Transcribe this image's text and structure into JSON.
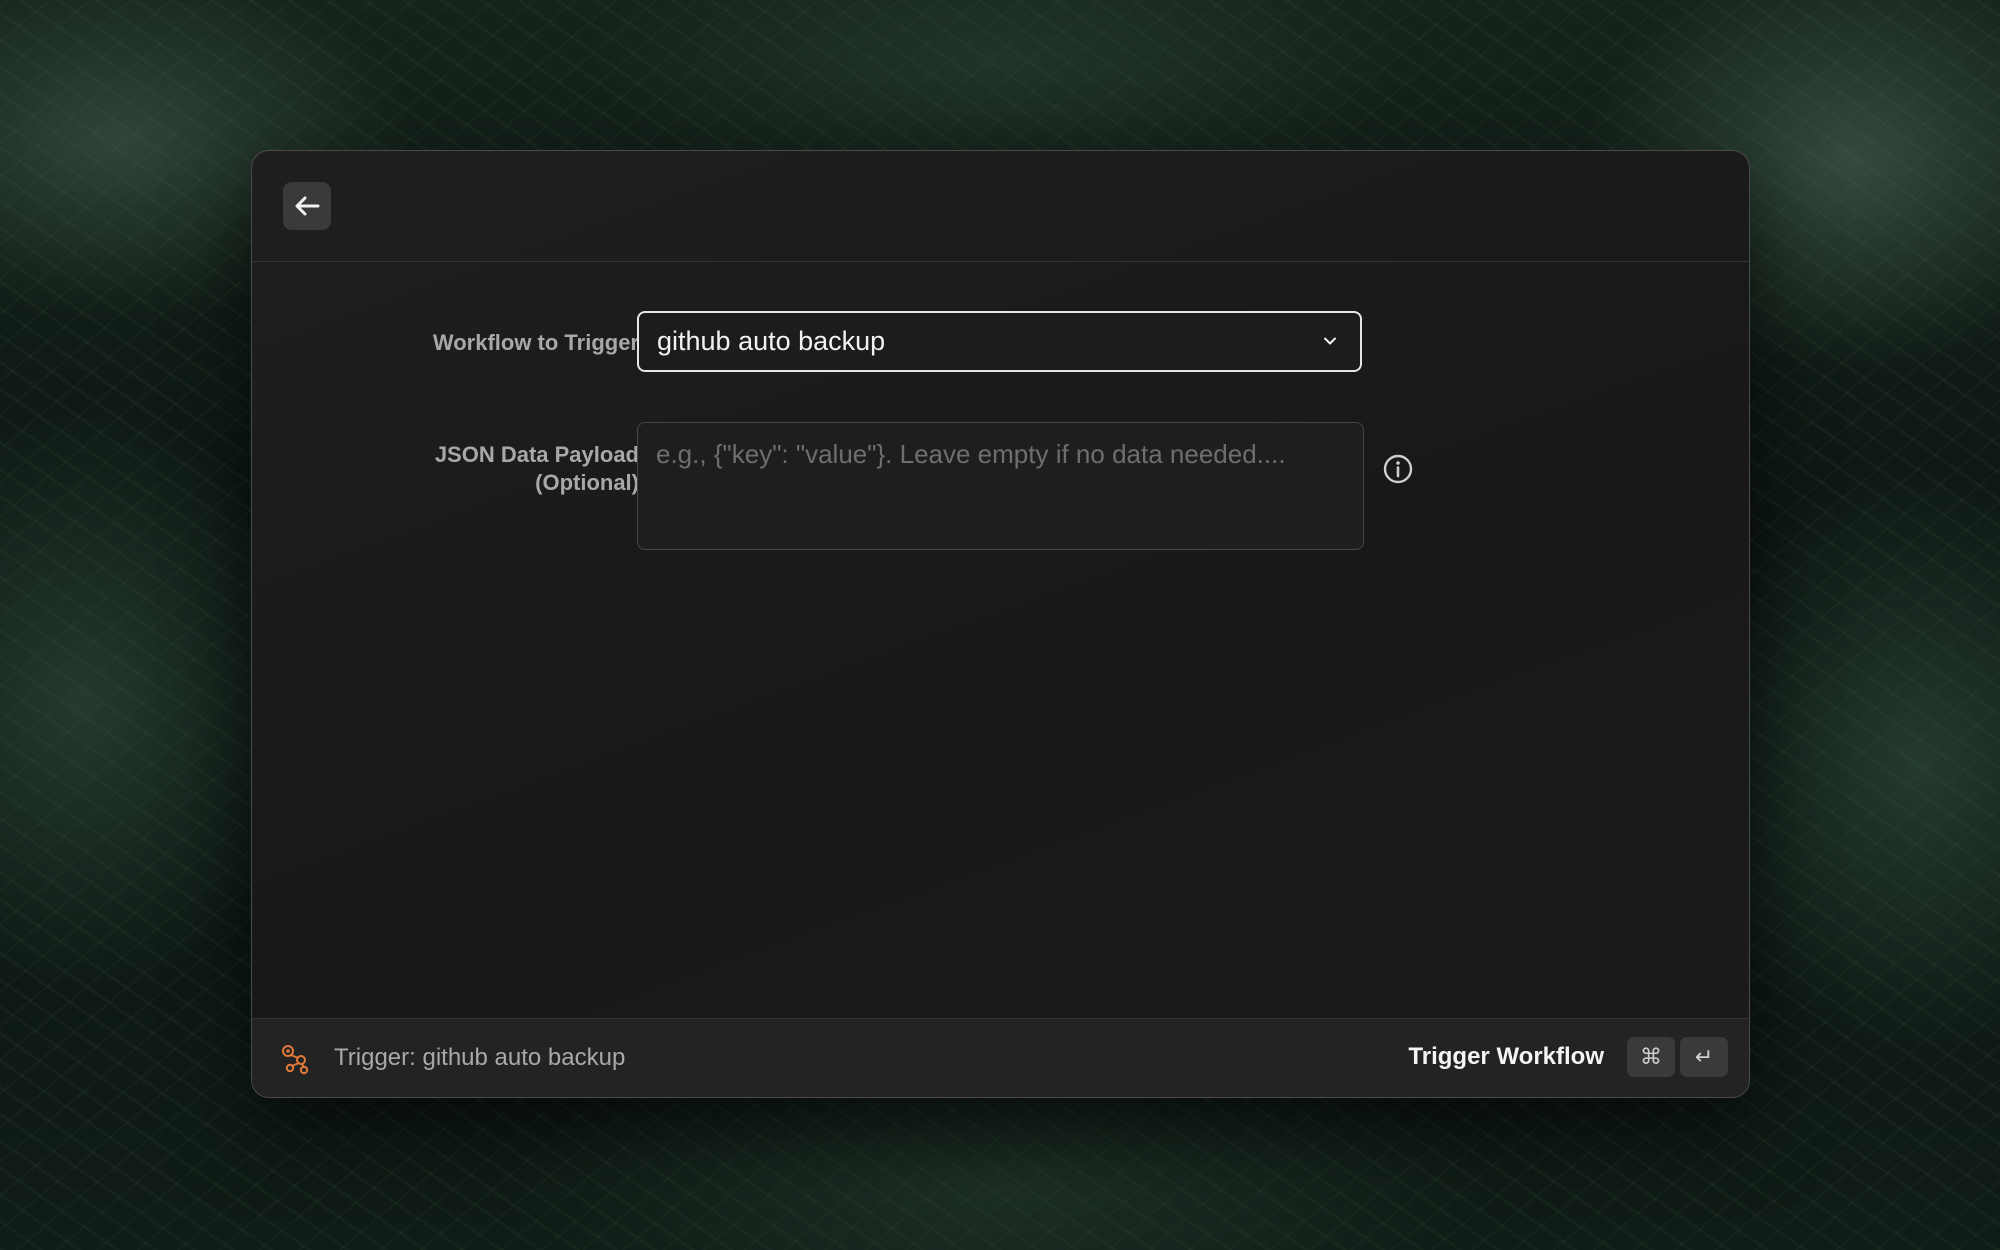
{
  "form": {
    "workflow_label": "Workflow to Trigger",
    "workflow_selected": "github auto backup",
    "payload_label_line1": "JSON Data Payload",
    "payload_label_line2": "(Optional)",
    "payload_placeholder": "e.g., {\"key\": \"value\"}. Leave empty if no data needed...."
  },
  "footer": {
    "status_text": "Trigger: github auto backup",
    "action_label": "Trigger Workflow",
    "shortcut_modifier": "⌘",
    "shortcut_key": "↵"
  },
  "icons": {
    "back": "arrow-left-icon",
    "dropdown": "chevron-down-icon",
    "info": "info-icon",
    "workflow": "workflow-icon"
  },
  "colors": {
    "accent_icon": "#e0793a",
    "selected_border": "#e6e6e6"
  }
}
